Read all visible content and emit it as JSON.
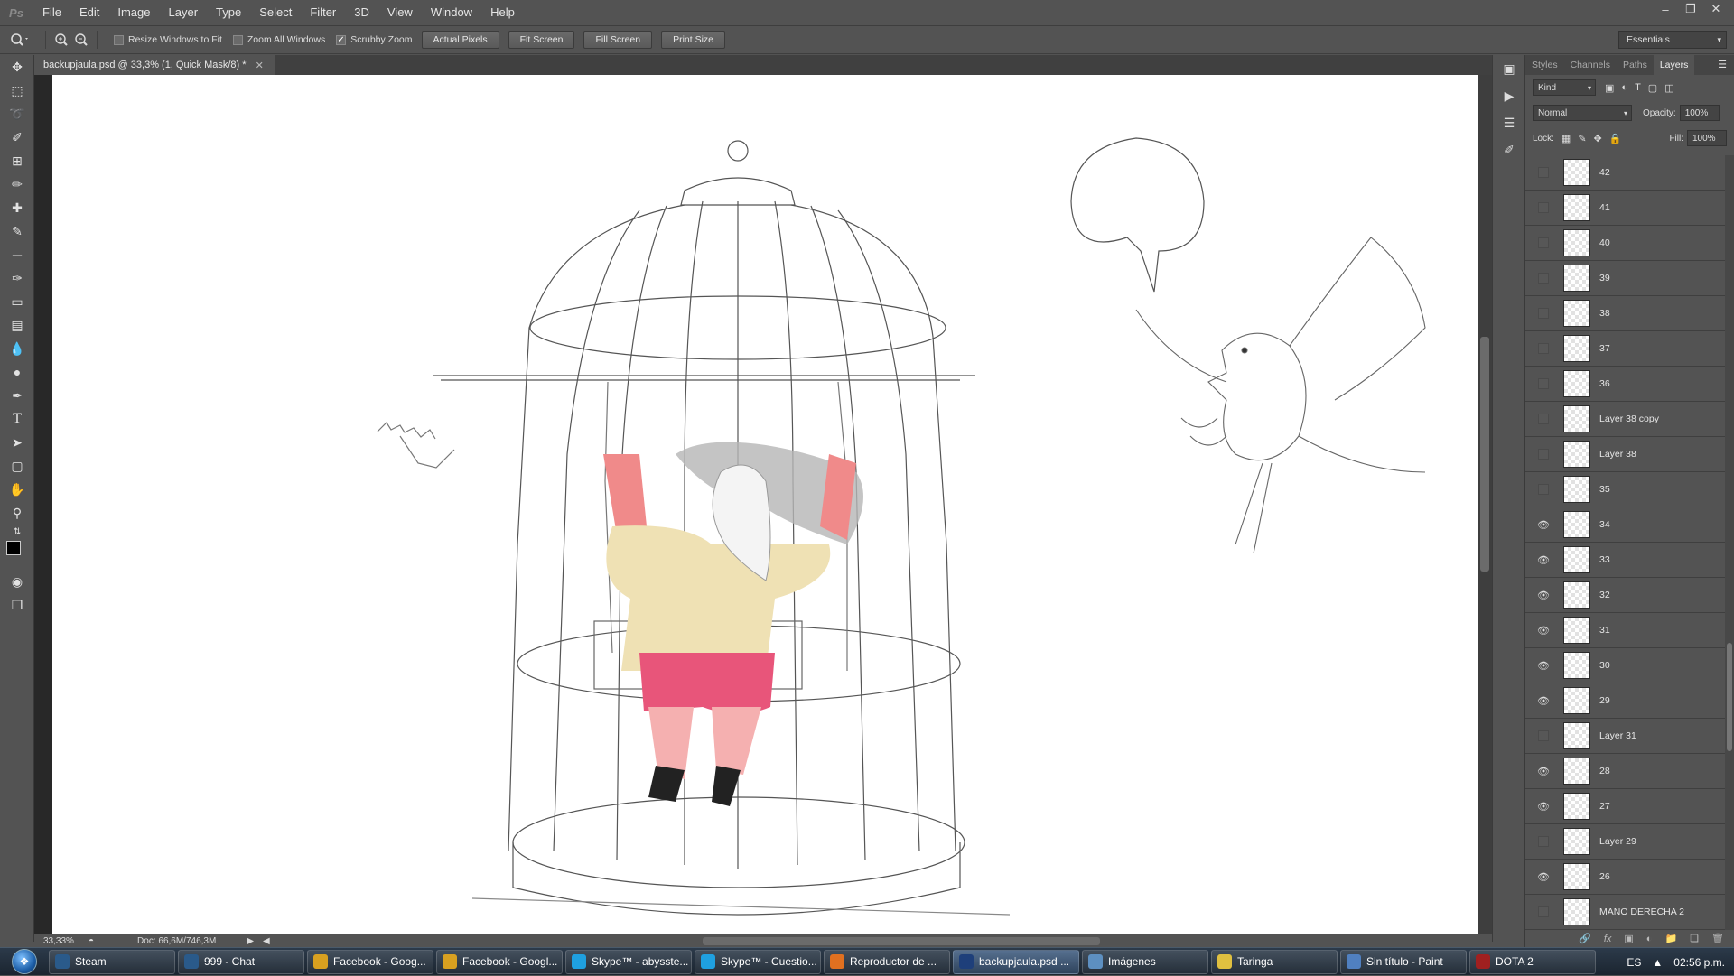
{
  "menu": [
    "File",
    "Edit",
    "Image",
    "Layer",
    "Type",
    "Select",
    "Filter",
    "3D",
    "View",
    "Window",
    "Help"
  ],
  "options": {
    "resize_windows": "Resize Windows to Fit",
    "zoom_all": "Zoom All Windows",
    "scrubby": "Scrubby Zoom",
    "btn_actual": "Actual Pixels",
    "btn_fit": "Fit Screen",
    "btn_fill": "Fill Screen",
    "btn_print": "Print Size",
    "workspace": "Essentials",
    "scrubby_checked": true
  },
  "document": {
    "tab_title": "backupjaula.psd @ 33,3% (1, Quick Mask/8) *",
    "zoom": "33,33%",
    "doc_size": "Doc: 66,6M/746,3M"
  },
  "panel": {
    "tabs": [
      "Styles",
      "Channels",
      "Paths",
      "Layers"
    ],
    "active_tab": "Layers",
    "kind": "Kind",
    "blend_mode": "Normal",
    "opacity_label": "Opacity:",
    "opacity": "100%",
    "lock_label": "Lock:",
    "fill_label": "Fill:",
    "fill": "100%",
    "layers": [
      {
        "name": "42",
        "visible": false
      },
      {
        "name": "41",
        "visible": false
      },
      {
        "name": "40",
        "visible": false
      },
      {
        "name": "39",
        "visible": false
      },
      {
        "name": "38",
        "visible": false
      },
      {
        "name": "37",
        "visible": false
      },
      {
        "name": "36",
        "visible": false
      },
      {
        "name": "Layer 38 copy",
        "visible": false
      },
      {
        "name": "Layer 38",
        "visible": false
      },
      {
        "name": "35",
        "visible": false
      },
      {
        "name": "34",
        "visible": true
      },
      {
        "name": "33",
        "visible": true
      },
      {
        "name": "32",
        "visible": true
      },
      {
        "name": "31",
        "visible": true
      },
      {
        "name": "30",
        "visible": true
      },
      {
        "name": "29",
        "visible": true
      },
      {
        "name": "Layer 31",
        "visible": false
      },
      {
        "name": "28",
        "visible": true
      },
      {
        "name": "27",
        "visible": true
      },
      {
        "name": "Layer 29",
        "visible": false
      },
      {
        "name": "26",
        "visible": true
      },
      {
        "name": "MANO DERECHA 2",
        "visible": false
      }
    ]
  },
  "taskbar": {
    "tasks": [
      {
        "label": "Steam",
        "color": "#2a5a8a",
        "icon": "steam-icon"
      },
      {
        "label": "999 - Chat",
        "color": "#2a5a8a",
        "icon": "steam-icon"
      },
      {
        "label": "Facebook - Goog...",
        "color": "#d8a020",
        "icon": "chrome-icon"
      },
      {
        "label": "Facebook - Googl...",
        "color": "#d8a020",
        "icon": "chrome-icon"
      },
      {
        "label": "Skype™ - abysste...",
        "color": "#1fa0e0",
        "icon": "skype-icon"
      },
      {
        "label": "Skype™ - Cuestio...",
        "color": "#1fa0e0",
        "icon": "skype-icon"
      },
      {
        "label": "Reproductor de ...",
        "color": "#e07020",
        "icon": "media-player-icon"
      },
      {
        "label": "backupjaula.psd ...",
        "color": "#1e3f7a",
        "icon": "photoshop-icon",
        "active": true
      },
      {
        "label": "Imágenes",
        "color": "#5d8fc0",
        "icon": "folder-icon"
      },
      {
        "label": "Taringa",
        "color": "#e0c040",
        "icon": "folder-icon"
      },
      {
        "label": "Sin título - Paint",
        "color": "#5080c0",
        "icon": "paint-icon"
      },
      {
        "label": "DOTA 2",
        "color": "#a02020",
        "icon": "dota-icon"
      }
    ],
    "lang": "ES",
    "time": "02:56 p.m."
  }
}
